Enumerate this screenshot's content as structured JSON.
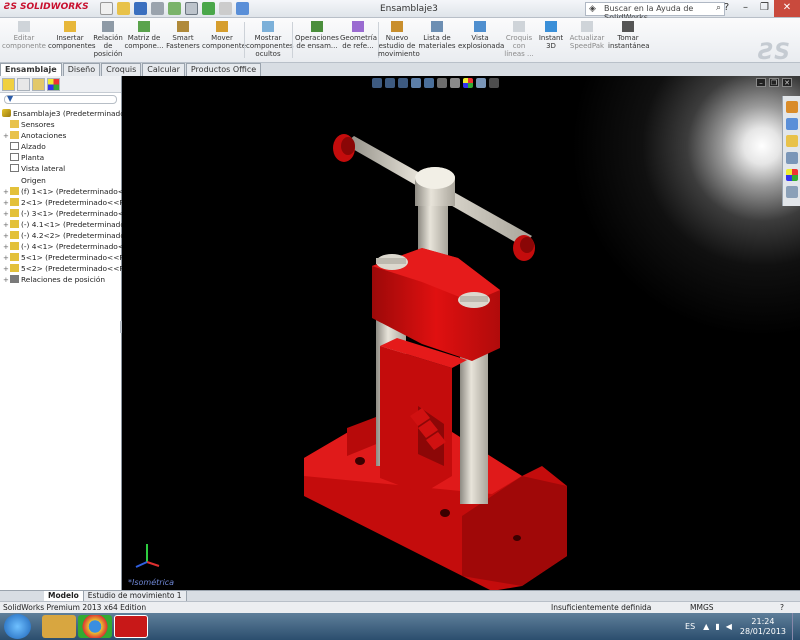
{
  "app": {
    "brand": "SOLIDWORKS",
    "document_title": "Ensamblaje3",
    "help_search_placeholder": "Buscar en la Ayuda de SolidWorks"
  },
  "ribbon": {
    "buttons": [
      {
        "label": "Editar componente",
        "enabled": false
      },
      {
        "label": "Insertar componentes",
        "enabled": true
      },
      {
        "label": "Relación de posición",
        "enabled": true
      },
      {
        "label": "Matriz de compone...",
        "enabled": true
      },
      {
        "label": "Smart Fasteners",
        "enabled": true
      },
      {
        "label": "Mover componente",
        "enabled": true
      },
      {
        "label": "Mostrar componentes ocultos",
        "enabled": true
      },
      {
        "label": "Operaciones de ensam...",
        "enabled": true
      },
      {
        "label": "Geometría de refe...",
        "enabled": true
      },
      {
        "label": "Nuevo estudio de movimiento",
        "enabled": true
      },
      {
        "label": "Lista de materiales",
        "enabled": true
      },
      {
        "label": "Vista explosionada",
        "enabled": true
      },
      {
        "label": "Croquis con líneas ...",
        "enabled": false
      },
      {
        "label": "Instant 3D",
        "enabled": true
      },
      {
        "label": "Actualizar SpeedPak",
        "enabled": false
      },
      {
        "label": "Tomar instantánea",
        "enabled": true
      }
    ]
  },
  "tabs": [
    "Ensamblaje",
    "Diseño",
    "Croquis",
    "Calcular",
    "Productos Office"
  ],
  "active_tab": "Ensamblaje",
  "tree": {
    "root": "Ensamblaje3  (Predeterminado<",
    "items": [
      {
        "label": "Sensores",
        "expand": ""
      },
      {
        "label": "Anotaciones",
        "expand": "+"
      },
      {
        "label": "Alzado",
        "expand": ""
      },
      {
        "label": "Planta",
        "expand": ""
      },
      {
        "label": "Vista lateral",
        "expand": ""
      },
      {
        "label": "Origen",
        "expand": ""
      },
      {
        "label": "(f) 1<1> (Predeterminado<<",
        "expand": "+"
      },
      {
        "label": "2<1> (Predeterminado<<Pr",
        "expand": "+"
      },
      {
        "label": "(-) 3<1> (Predeterminado<<",
        "expand": "+"
      },
      {
        "label": "(-) 4.1<1> (Predeterminado-",
        "expand": "+"
      },
      {
        "label": "(-) 4.2<2> (Predeterminado-",
        "expand": "+"
      },
      {
        "label": "(-) 4<1> (Predeterminado<<",
        "expand": "+"
      },
      {
        "label": "5<1> (Predeterminado<<Pr",
        "expand": "+"
      },
      {
        "label": "5<2> (Predeterminado<<Pr",
        "expand": "+"
      },
      {
        "label": "Relaciones de posición",
        "expand": "+"
      }
    ]
  },
  "viewport": {
    "view_label": "*Isométrica",
    "model_color": "#e01010",
    "shaft_color": "#d8d4c8"
  },
  "bottom_tabs": [
    "Modelo",
    "Estudio de movimiento 1"
  ],
  "status": {
    "edition": "SolidWorks Premium 2013 x64 Edition",
    "state": "Insuficientemente definida",
    "units": "MMGS",
    "help": "?"
  },
  "taskbar": {
    "language": "ES",
    "time": "21:24",
    "date": "28/01/2013"
  }
}
